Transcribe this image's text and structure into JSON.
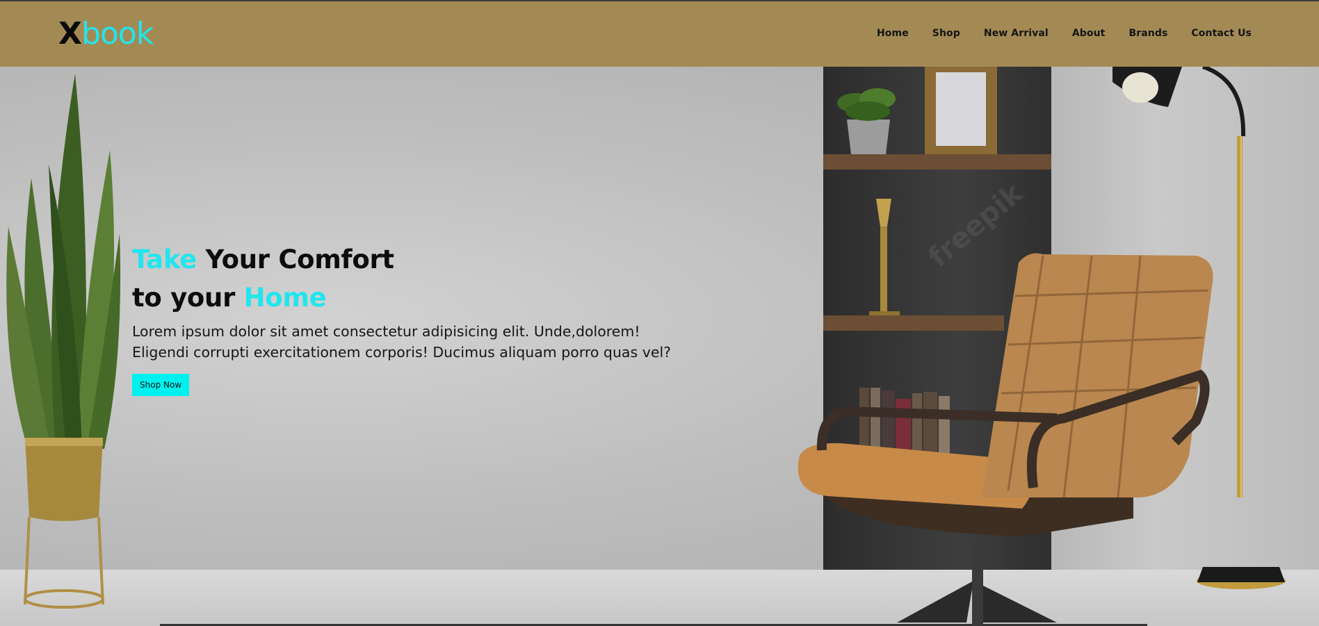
{
  "brand": {
    "logo_letter": "X",
    "logo_rest": "book"
  },
  "nav": {
    "items": [
      {
        "label": "Home"
      },
      {
        "label": "Shop"
      },
      {
        "label": "New Arrival"
      },
      {
        "label": "About"
      },
      {
        "label": "Brands"
      },
      {
        "label": "Contact Us"
      }
    ]
  },
  "hero": {
    "line1_accent": "Take",
    "line1_rest": " Your Comfort",
    "line2_start": "to your ",
    "line2_accent": "Home",
    "desc_line1": "Lorem ipsum dolor sit amet consectetur adipisicing elit. Unde,dolorem!",
    "desc_line2": "Eligendi corrupti exercitationem corporis! Ducimus aliquam porro quas vel?",
    "button_label": "Shop Now",
    "watermark": "freepik"
  },
  "colors": {
    "navbar": "#a38a55",
    "accent": "#22e5ee",
    "button": "#00f0f0"
  }
}
